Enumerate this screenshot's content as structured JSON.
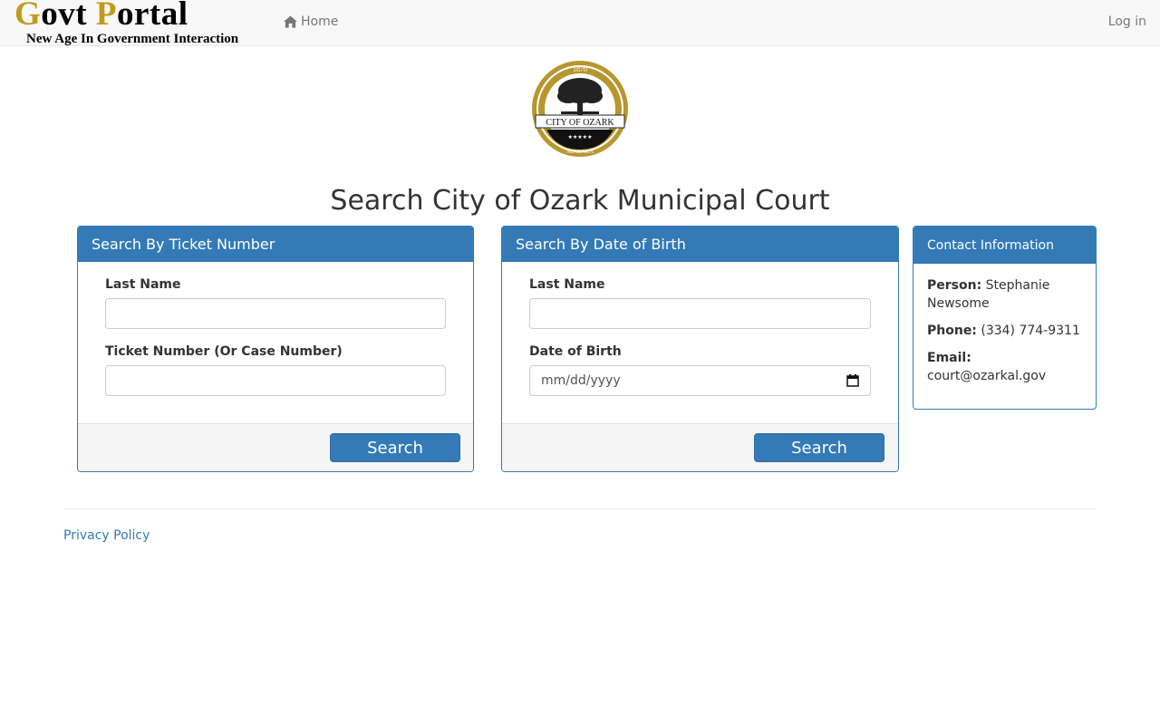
{
  "navbar": {
    "brand_g": "G",
    "brand_ovt": "ovt ",
    "brand_p": "P",
    "brand_ortal": "ortal",
    "tagline": "New Age In Government Interaction",
    "home_label": "Home",
    "login_label": "Log in"
  },
  "seal": {
    "year": "1870",
    "city": "CITY OF OZARK",
    "state": "ALABAMA",
    "stars": "★★★★★"
  },
  "page_title": "Search City of Ozark Municipal Court",
  "ticket_panel": {
    "heading": "Search By Ticket Number",
    "last_name_label": "Last Name",
    "last_name_value": "",
    "ticket_label": "Ticket Number (Or Case Number)",
    "ticket_value": "",
    "search_label": "Search"
  },
  "dob_panel": {
    "heading": "Search By Date of Birth",
    "last_name_label": "Last Name",
    "last_name_value": "",
    "dob_label": "Date of Birth",
    "dob_placeholder": "mm/dd/yyyy",
    "search_label": "Search"
  },
  "contact": {
    "heading": "Contact Information",
    "person_label": "Person:",
    "person_value": "Stephanie Newsome",
    "phone_label": "Phone:",
    "phone_value": "(334) 774-9311",
    "email_label": "Email:",
    "email_value": "court@ozarkal.gov"
  },
  "footer": {
    "privacy_label": "Privacy Policy"
  },
  "colors": {
    "primary": "#337ab7",
    "brand_gold": "#c29a1c",
    "seal_gold": "#b8962e",
    "nav_bg": "#f8f8f8"
  },
  "icons": {
    "home": "home-icon",
    "calendar": "calendar-icon"
  }
}
